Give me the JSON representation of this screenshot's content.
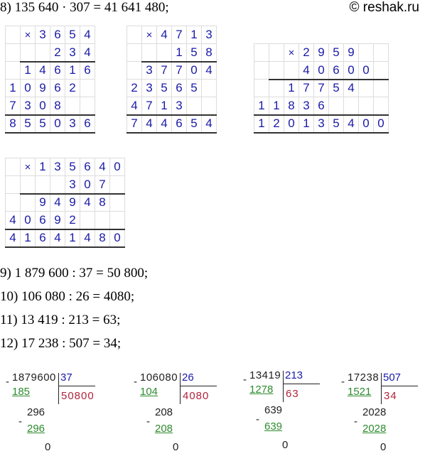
{
  "header": {
    "line8": "8) 135 640 · 307 = 41 641 480;",
    "watermark": "© reshak.ru"
  },
  "mult_tables": [
    {
      "rows": [
        [
          "",
          "×",
          "3",
          "6",
          "5",
          "4"
        ],
        [
          "",
          "",
          "",
          "2",
          "3",
          "4"
        ],
        [
          "",
          "1",
          "4",
          "6",
          "1",
          "6"
        ],
        [
          "1",
          "0",
          "9",
          "6",
          "2",
          ""
        ],
        [
          "7",
          "3",
          "0",
          "8",
          "",
          ""
        ],
        [
          "8",
          "5",
          "5",
          "0",
          "3",
          "6"
        ]
      ]
    },
    {
      "rows": [
        [
          "",
          "×",
          "4",
          "7",
          "1",
          "3"
        ],
        [
          "",
          "",
          "",
          "1",
          "5",
          "8"
        ],
        [
          "",
          "3",
          "7",
          "7",
          "0",
          "4"
        ],
        [
          "2",
          "3",
          "5",
          "6",
          "5",
          ""
        ],
        [
          "4",
          "7",
          "1",
          "3",
          "",
          ""
        ],
        [
          "7",
          "4",
          "4",
          "6",
          "5",
          "4"
        ]
      ]
    },
    {
      "rows": [
        [
          "",
          "",
          "×",
          "2",
          "9",
          "5",
          "9",
          "",
          ""
        ],
        [
          "",
          "",
          "",
          "4",
          "0",
          "6",
          "0",
          "0",
          ""
        ],
        [
          "",
          "",
          "1",
          "7",
          "7",
          "5",
          "4",
          "",
          ""
        ],
        [
          "1",
          "1",
          "8",
          "3",
          "6",
          "",
          "",
          "",
          ""
        ],
        [
          "1",
          "2",
          "0",
          "1",
          "3",
          "5",
          "4",
          "0",
          "0"
        ]
      ]
    },
    {
      "rows": [
        [
          "",
          "×",
          "1",
          "3",
          "5",
          "6",
          "4",
          "0"
        ],
        [
          "",
          "",
          "",
          "",
          "3",
          "0",
          "7",
          ""
        ],
        [
          "",
          "",
          "9",
          "4",
          "9",
          "4",
          "8",
          ""
        ],
        [
          "4",
          "0",
          "6",
          "9",
          "2",
          "",
          "",
          ""
        ],
        [
          "4",
          "1",
          "6",
          "4",
          "1",
          "4",
          "8",
          "0"
        ]
      ]
    }
  ],
  "lines": {
    "l9": "9) 1 879 600 : 37 = 50 800;",
    "l10": "10) 106 080 : 26 = 4080;",
    "l11": "11) 13 419 : 213 = 63;",
    "l12": "12) 17 238 : 507 = 34;"
  },
  "divisions": [
    {
      "dividend": "1879600",
      "divisor": "37",
      "first": "185",
      "quotient": "50800",
      "rem1": "296",
      "sub2": "296",
      "zero": "0"
    },
    {
      "dividend": "106080",
      "divisor": "26",
      "first": "104",
      "quotient": "4080",
      "rem1": "208",
      "sub2": "208",
      "zero": "0"
    },
    {
      "dividend": "13419",
      "divisor": "213",
      "first": "1278",
      "quotient": "63",
      "rem1": "639",
      "sub2": "639",
      "zero": "0"
    },
    {
      "dividend": "17238",
      "divisor": "507",
      "first": "1521",
      "quotient": "34",
      "rem1": "2028",
      "sub2": "2028",
      "zero": "0"
    }
  ]
}
